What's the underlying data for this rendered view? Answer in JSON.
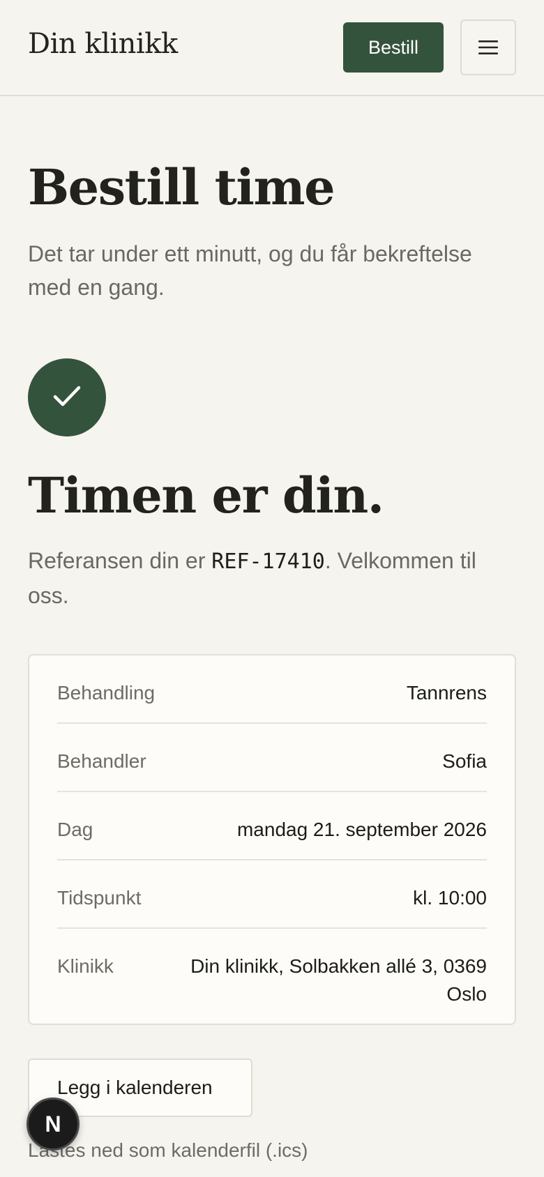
{
  "header": {
    "brand": "Din klinikk",
    "order_label": "Bestill",
    "menu_icon": "hamburger-menu-icon"
  },
  "intro": {
    "title": "Bestill time",
    "subtitle": "Det tar under ett minutt, og du får bekreftelse med en gang."
  },
  "confirmation": {
    "icon": "checkmark-icon",
    "title": "Timen er din.",
    "ref_prefix": "Referansen din er ",
    "ref_code": "REF-17410",
    "ref_suffix": ". Velkommen til oss."
  },
  "details": [
    {
      "label": "Behandling",
      "value": "Tannrens"
    },
    {
      "label": "Behandler",
      "value": "Sofia"
    },
    {
      "label": "Dag",
      "value": "mandag 21. september 2026"
    },
    {
      "label": "Tidspunkt",
      "value": "kl. 10:00"
    },
    {
      "label": "Klinikk",
      "value": "Din klinikk, Solbakken allé 3, 0369 Oslo"
    }
  ],
  "calendar": {
    "button_label": "Legg i kalenderen",
    "note": "Lastes ned som kalenderfil (.ics)"
  },
  "badge": {
    "letter": "N"
  },
  "colors": {
    "accent": "#34533c",
    "background": "#f6f4ef",
    "card": "#fdfcf9"
  }
}
